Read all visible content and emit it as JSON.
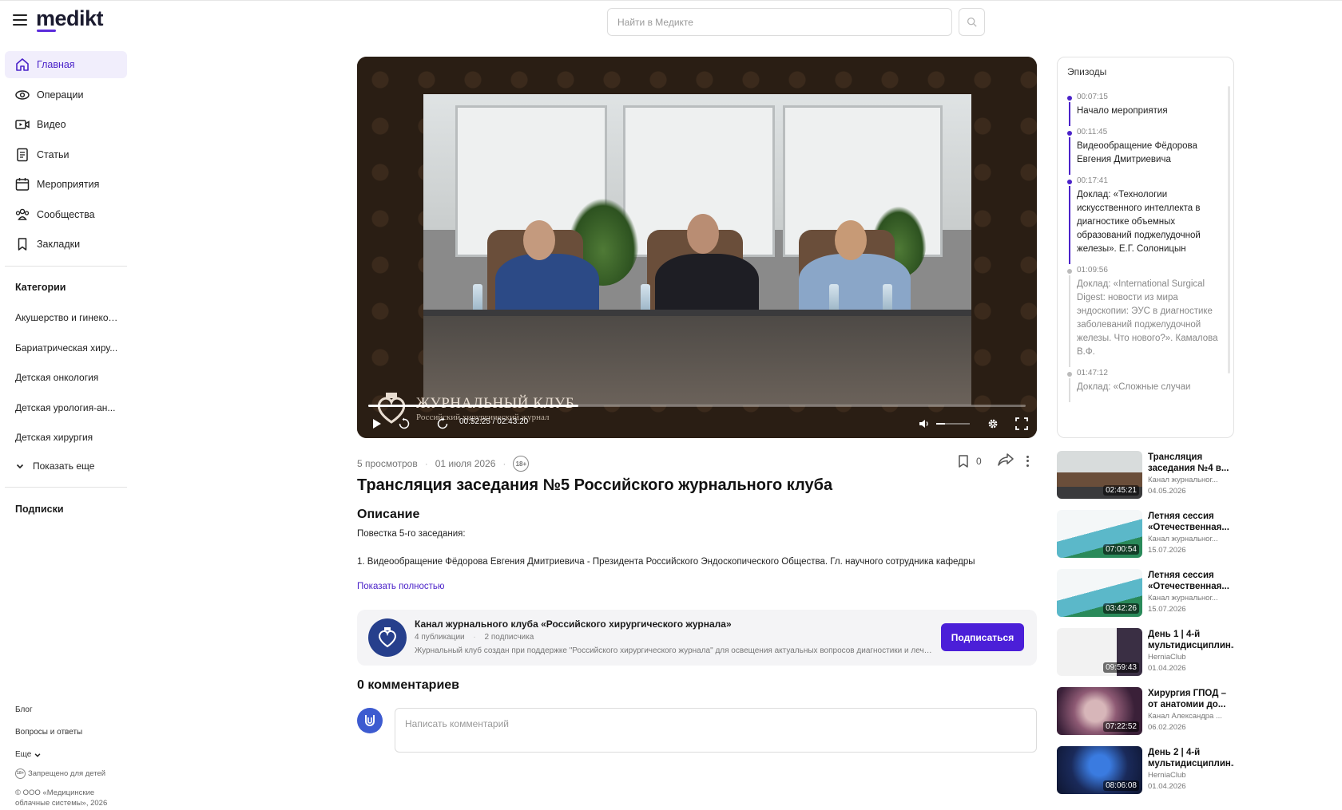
{
  "header": {
    "logo": "medikt",
    "search_placeholder": "Найти в Медикте"
  },
  "nav": [
    {
      "label": "Главная",
      "icon": "home-icon",
      "active": true
    },
    {
      "label": "Операции",
      "icon": "eye-icon"
    },
    {
      "label": "Видео",
      "icon": "video-icon"
    },
    {
      "label": "Статьи",
      "icon": "document-icon"
    },
    {
      "label": "Мероприятия",
      "icon": "calendar-icon"
    },
    {
      "label": "Сообщества",
      "icon": "community-icon"
    },
    {
      "label": "Закладки",
      "icon": "bookmark-icon"
    }
  ],
  "categories": {
    "heading": "Категории",
    "items": [
      "Акушерство и гинеколо...",
      "Бариатрическая хиру...",
      "Детская онкология",
      "Детская урология-ан...",
      "Детская хирургия"
    ],
    "show_more": "Показать еще"
  },
  "subscriptions": {
    "heading": "Подписки"
  },
  "footer": {
    "blog": "Блог",
    "faq": "Вопросы и ответы",
    "more": "Еще",
    "age_note": "Запрещено для детей",
    "copyright_1": "© ООО «Медицинские",
    "copyright_2": "облачные системы», 2026"
  },
  "player": {
    "overlay_title": "ЖУРНАЛЬНЫЙ КЛУБ",
    "overlay_sub": "Российский хирургический журнал",
    "time": "00:52:25 / 02:43:20",
    "progress": 0.32,
    "volume": 0.25
  },
  "video": {
    "views": "5 просмотров",
    "date": "01 июля 2026",
    "age": "18+",
    "bookmarks": "0",
    "title": "Трансляция заседания №5 Российского журнального клуба",
    "description_heading": "Описание",
    "description_line1": "Повестка 5-го заседания:",
    "description_line2": "1. Видеообращение Фёдорова Евгения Дмитриевича - Президента Российского Эндоскопического Общества. Гл. научного сотрудника кафедры",
    "show_full": "Показать полностью"
  },
  "channel": {
    "name": "Канал журнального клуба «Российского хирургического журнала»",
    "publications": "4 публикации",
    "subscribers": "2 подписчика",
    "description": "Журнальный клуб создан при поддержке \"Российского хирургического журнала\" для освещения актуальных вопросов диагностики и лечения",
    "subscribe_label": "Подписаться"
  },
  "comments": {
    "heading": "0 комментариев",
    "placeholder": "Написать комментарий"
  },
  "episodes": {
    "heading": "Эпизоды",
    "items": [
      {
        "time": "00:07:15",
        "text": "Начало мероприятия",
        "active": true
      },
      {
        "time": "00:11:45",
        "text": "Видеообращение Фёдорова Евгения Дмитриевича",
        "active": true
      },
      {
        "time": "00:17:41",
        "text": "Доклад: «Технологии искусственного интеллекта в диагностике объемных образований поджелудочной железы». Е.Г. Солоницын",
        "active": true
      },
      {
        "time": "01:09:56",
        "text": "Доклад: «International Surgical Digest: новости из мира эндоскопии: ЭУС в диагностике заболеваний поджелудочной железы. Что нового?». Камалова В.Ф.",
        "active": false
      },
      {
        "time": "01:47:12",
        "text": "Доклад: «Сложные случаи",
        "active": false
      }
    ]
  },
  "recommendations": [
    {
      "title": "Трансляция заседания №4 в...",
      "channel": "Канал журнальног...",
      "date": "04.05.2026",
      "duration": "02:45:21",
      "thumb": "meeting"
    },
    {
      "title": "Летняя сессия «Отечественная...",
      "channel": "Канал журнальног...",
      "date": "15.07.2026",
      "duration": "07:00:54",
      "thumb": "slide"
    },
    {
      "title": "Летняя сессия «Отечественная...",
      "channel": "Канал журнальног...",
      "date": "15.07.2026",
      "duration": "03:42:26",
      "thumb": "slide"
    },
    {
      "title": "День 1 | 4-й мультидисциплин...",
      "channel": "HerniaClub",
      "date": "01.04.2026",
      "duration": "09:59:43",
      "thumb": "doc"
    },
    {
      "title": "Хирургия ГПОД – от анатомии до...",
      "channel": "Канал Александра ...",
      "date": "06.02.2026",
      "duration": "07:22:52",
      "thumb": "endo"
    },
    {
      "title": "День 2 | 4-й мультидисциплин...",
      "channel": "HerniaClub",
      "date": "01.04.2026",
      "duration": "08:06:08",
      "thumb": "stage"
    }
  ],
  "colors": {
    "accent": "#4b23c9",
    "button": "#4b1fd8"
  }
}
